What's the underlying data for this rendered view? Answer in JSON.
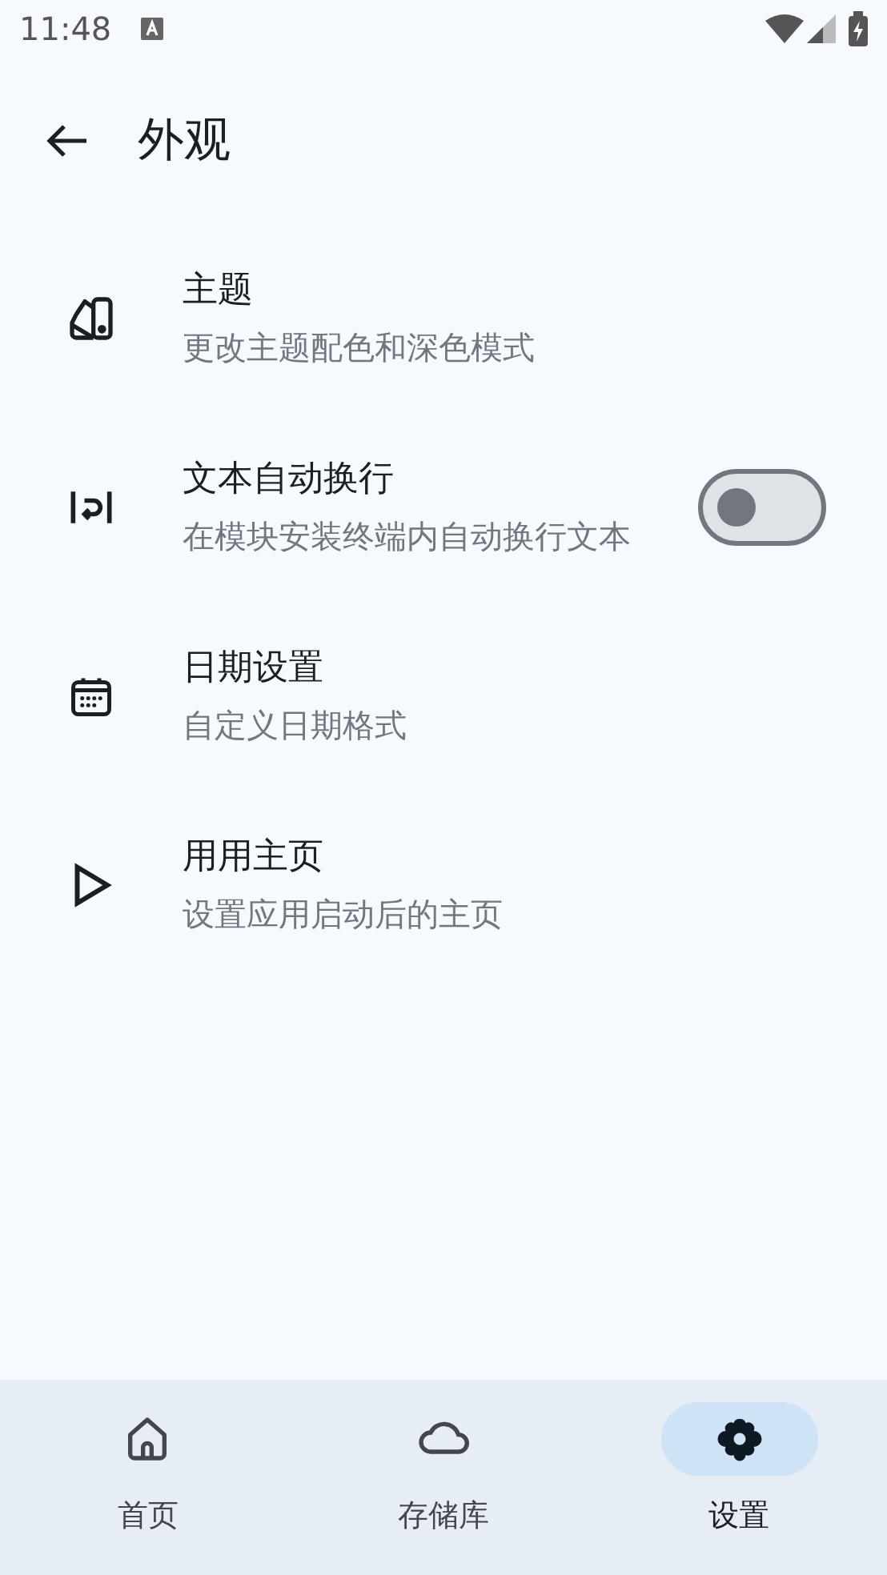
{
  "status_bar": {
    "time": "11:48"
  },
  "app_bar": {
    "title": "外观"
  },
  "settings": [
    {
      "title": "主题",
      "subtitle": "更改主题配色和深色模式"
    },
    {
      "title": "文本自动换行",
      "subtitle": "在模块安装终端内自动换行文本",
      "toggle": {
        "on": false
      }
    },
    {
      "title": "日期设置",
      "subtitle": "自定义日期格式"
    },
    {
      "title": "用用主页",
      "subtitle": "设置应用启动后的主页"
    }
  ],
  "bottom_nav": [
    {
      "label": "首页",
      "selected": false
    },
    {
      "label": "存储库",
      "selected": false
    },
    {
      "label": "设置",
      "selected": true
    }
  ]
}
